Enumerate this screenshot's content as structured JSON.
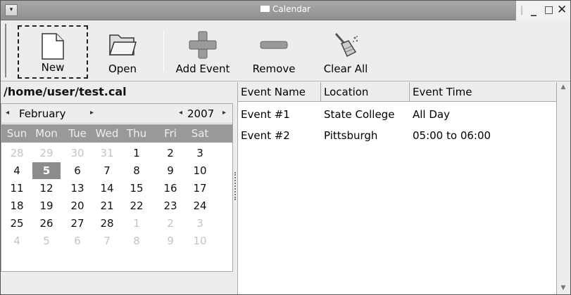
{
  "window": {
    "title": "Calendar",
    "controls": {
      "minimize": "_",
      "maximize": "□",
      "close": "✕",
      "menu": "▾"
    }
  },
  "toolbar": {
    "buttons": [
      {
        "label": "New",
        "icon": "new-document-icon",
        "focused": true
      },
      {
        "label": "Open",
        "icon": "folder-icon"
      },
      {
        "label": "Add Event",
        "icon": "plus-icon"
      },
      {
        "label": "Remove",
        "icon": "minus-icon"
      },
      {
        "label": "Clear All",
        "icon": "broom-icon"
      }
    ]
  },
  "file": {
    "path": "/home/user/test.cal"
  },
  "calendar": {
    "month": "February",
    "year": "2007",
    "prev_month": "◂",
    "next_month": "▸",
    "prev_year": "◂",
    "next_year": "▸",
    "weekdays": [
      "Sun",
      "Mon",
      "Tue",
      "Wed",
      "Thu",
      "Fri",
      "Sat"
    ],
    "weeks": [
      [
        {
          "d": "28",
          "o": true
        },
        {
          "d": "29",
          "o": true
        },
        {
          "d": "30",
          "o": true
        },
        {
          "d": "31",
          "o": true
        },
        {
          "d": "1"
        },
        {
          "d": "2"
        },
        {
          "d": "3"
        }
      ],
      [
        {
          "d": "4"
        },
        {
          "d": "5",
          "sel": true
        },
        {
          "d": "6"
        },
        {
          "d": "7"
        },
        {
          "d": "8"
        },
        {
          "d": "9"
        },
        {
          "d": "10"
        }
      ],
      [
        {
          "d": "11"
        },
        {
          "d": "12"
        },
        {
          "d": "13"
        },
        {
          "d": "14"
        },
        {
          "d": "15"
        },
        {
          "d": "16"
        },
        {
          "d": "17"
        }
      ],
      [
        {
          "d": "18"
        },
        {
          "d": "19"
        },
        {
          "d": "20"
        },
        {
          "d": "21"
        },
        {
          "d": "22"
        },
        {
          "d": "23"
        },
        {
          "d": "24"
        }
      ],
      [
        {
          "d": "25"
        },
        {
          "d": "26"
        },
        {
          "d": "27"
        },
        {
          "d": "28"
        },
        {
          "d": "1",
          "o": true
        },
        {
          "d": "2",
          "o": true
        },
        {
          "d": "3",
          "o": true
        }
      ],
      [
        {
          "d": "4",
          "o": true
        },
        {
          "d": "5",
          "o": true
        },
        {
          "d": "6",
          "o": true
        },
        {
          "d": "7",
          "o": true
        },
        {
          "d": "8",
          "o": true
        },
        {
          "d": "9",
          "o": true
        },
        {
          "d": "10",
          "o": true
        }
      ]
    ],
    "selected_day": "5"
  },
  "events": {
    "columns": [
      "Event Name",
      "Location",
      "Event Time"
    ],
    "rows": [
      [
        "Event #1",
        "State College",
        "All Day"
      ],
      [
        "Event #2",
        "Pittsburgh",
        "05:00 to 06:00"
      ]
    ]
  },
  "colors": {
    "titlebar": "#9a9a9a",
    "weekday_header": "#999999",
    "selected_day": "#8c8c8c",
    "other_month_day": "#c4c4c4"
  }
}
